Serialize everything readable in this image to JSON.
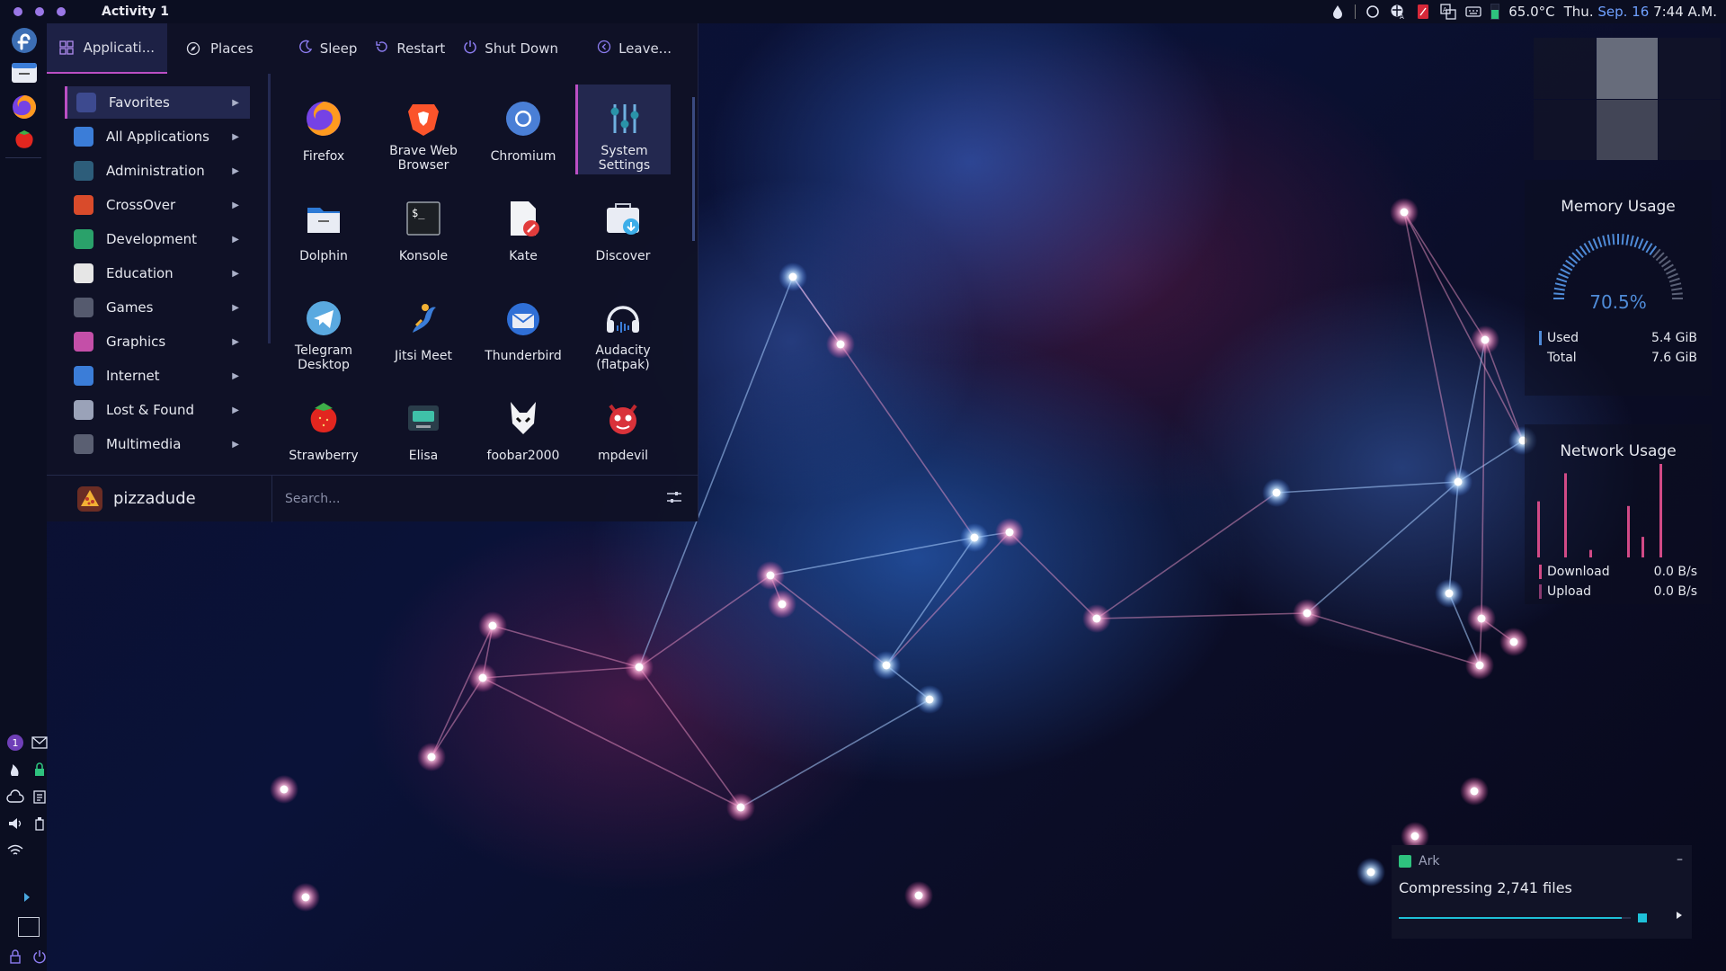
{
  "topbar": {
    "activity_title": "Activity 1",
    "temperature": "65.0°C",
    "date_prefix": "Thu.",
    "date_accent": "Sep. 16",
    "time": "7:44 A.M.",
    "tray_icons": [
      "droplet-icon",
      "circle-icon",
      "network-globe-icon",
      "pdf-icon",
      "translate-icon",
      "keyboard-icon",
      "temperature-bar-icon"
    ],
    "temp_fill_fraction": 0.65
  },
  "dock": {
    "apps": [
      "fedora-icon",
      "files-icon",
      "firefox-icon",
      "strawberry-icon"
    ],
    "tray_badge": "1",
    "pager_label": "1"
  },
  "launcher": {
    "tabs": [
      {
        "label": "Applicati...",
        "icon": "grid-icon"
      },
      {
        "label": "Places",
        "icon": "compass-icon"
      }
    ],
    "power": [
      {
        "label": "Sleep",
        "icon": "moon-icon"
      },
      {
        "label": "Restart",
        "icon": "restart-icon"
      },
      {
        "label": "Shut Down",
        "icon": "power-icon"
      }
    ],
    "leave": {
      "label": "Leave...",
      "icon": "chevron-left-icon"
    },
    "categories": [
      {
        "label": "Favorites",
        "icon": "bookmark-icon",
        "color": "#3d4a8f"
      },
      {
        "label": "All Applications",
        "icon": "apps-grid-icon",
        "color": "#3b7dd8"
      },
      {
        "label": "Administration",
        "icon": "sliders-icon",
        "color": "#2d5d7a"
      },
      {
        "label": "CrossOver",
        "icon": "crossover-icon",
        "color": "#d94b2b"
      },
      {
        "label": "Development",
        "icon": "code-icon",
        "color": "#2aa16a"
      },
      {
        "label": "Education",
        "icon": "book-icon",
        "color": "#e6e6e6"
      },
      {
        "label": "Games",
        "icon": "gamepad-icon",
        "color": "#555a6e"
      },
      {
        "label": "Graphics",
        "icon": "palette-icon",
        "color": "#c44fa8"
      },
      {
        "label": "Internet",
        "icon": "globe-icon",
        "color": "#3b7dd8"
      },
      {
        "label": "Lost & Found",
        "icon": "folder-search-icon",
        "color": "#9aa2b8"
      },
      {
        "label": "Multimedia",
        "icon": "film-icon",
        "color": "#5a5f72"
      }
    ],
    "apps": [
      {
        "label": "Firefox",
        "icon": "firefox-icon"
      },
      {
        "label": "Brave Web\nBrowser",
        "icon": "brave-icon"
      },
      {
        "label": "Chromium",
        "icon": "chromium-icon"
      },
      {
        "label": "System\nSettings",
        "icon": "system-settings-icon"
      },
      {
        "label": "Dolphin",
        "icon": "dolphin-folder-icon"
      },
      {
        "label": "Konsole",
        "icon": "terminal-icon"
      },
      {
        "label": "Kate",
        "icon": "kate-icon"
      },
      {
        "label": "Discover",
        "icon": "discover-icon"
      },
      {
        "label": "Telegram\nDesktop",
        "icon": "telegram-icon"
      },
      {
        "label": "Jitsi Meet",
        "icon": "jitsi-icon"
      },
      {
        "label": "Thunderbird",
        "icon": "thunderbird-icon"
      },
      {
        "label": "Audacity\n(flatpak)",
        "icon": "audacity-icon"
      },
      {
        "label": "Strawberry",
        "icon": "strawberry-icon"
      },
      {
        "label": "Elisa",
        "icon": "elisa-icon"
      },
      {
        "label": "foobar2000",
        "icon": "foobar-icon"
      },
      {
        "label": "mpdevil",
        "icon": "mpdevil-icon"
      }
    ],
    "user": {
      "name": "pizzadude"
    },
    "search": {
      "placeholder": "Search..."
    }
  },
  "widgets": {
    "memory": {
      "title": "Memory Usage",
      "percent": "70.5%",
      "percent_value": 70.5,
      "used_label": "Used",
      "used_value": "5.4 GiB",
      "total_label": "Total",
      "total_value": "7.6 GiB",
      "accent": "#4f8bd8"
    },
    "network": {
      "title": "Network Usage",
      "download_label": "Download",
      "download_value": "0.0 B/s",
      "upload_label": "Upload",
      "upload_value": "0.0 B/s",
      "accent": "#d24a86",
      "bars": [
        0.6,
        0.9,
        0.08,
        0.55,
        0.22,
        1.0
      ]
    }
  },
  "notification": {
    "app": "Ark",
    "body": "Compressing 2,741 files",
    "progress": 0.96,
    "close": "–"
  }
}
